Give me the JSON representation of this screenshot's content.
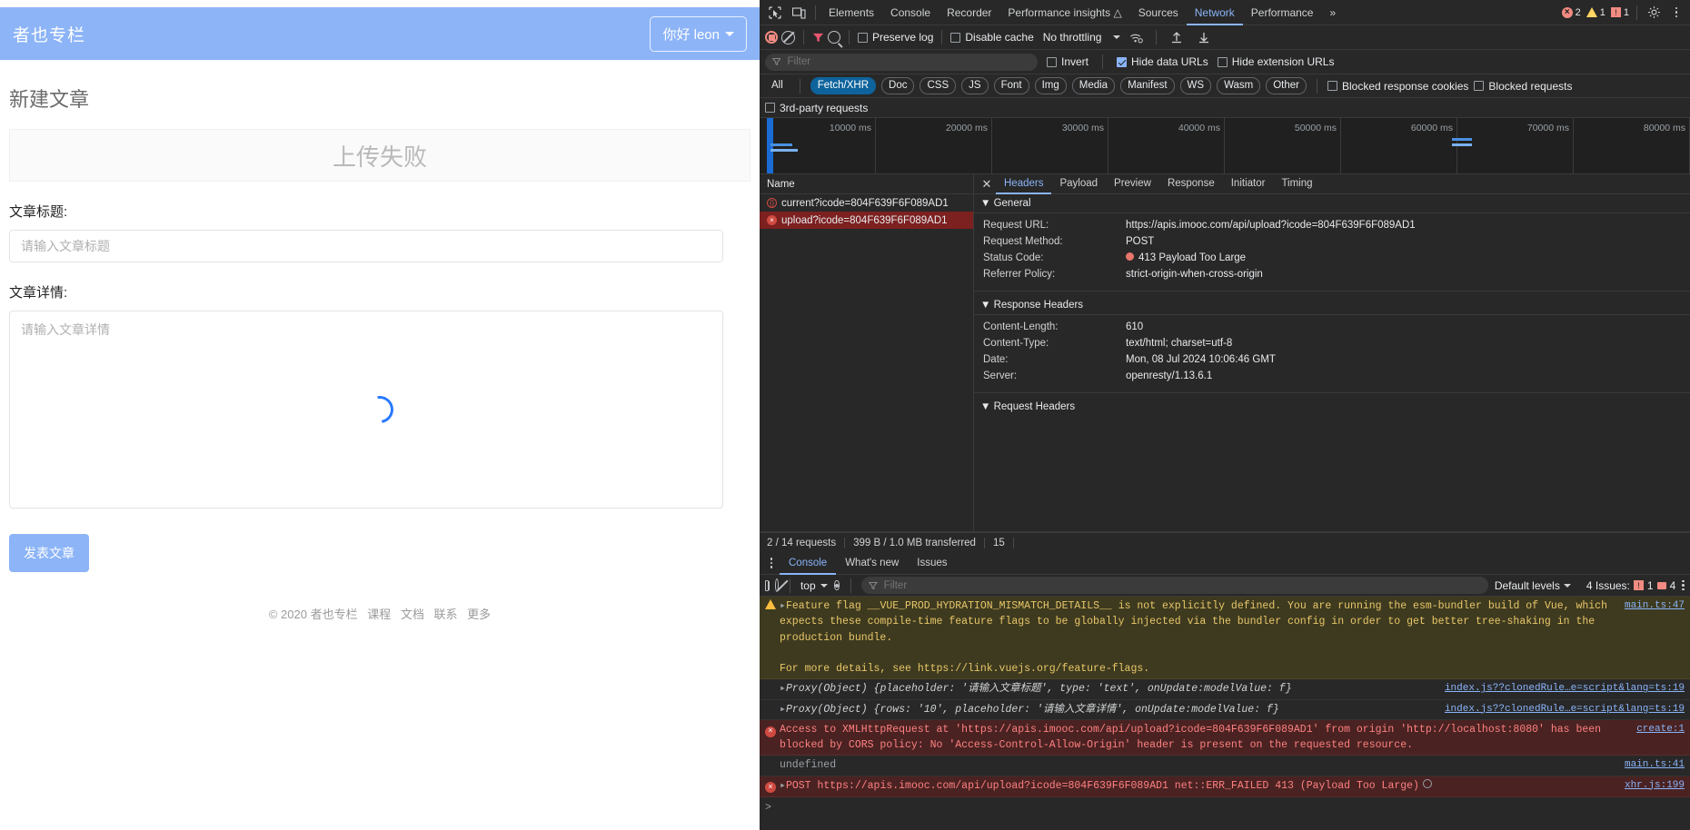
{
  "webpage": {
    "brand": "者也专栏",
    "user_button": "你好 leon",
    "page_title": "新建文章",
    "upload_status": "上传失败",
    "title_label": "文章标题:",
    "title_placeholder": "请输入文章标题",
    "title_value": "",
    "detail_label": "文章详情:",
    "detail_placeholder": "请输入文章详情",
    "detail_value": "",
    "submit_label": "发表文章",
    "footer": {
      "copyright": "© 2020 者也专栏",
      "links": [
        "课程",
        "文档",
        "联系",
        "更多"
      ]
    },
    "accent_color": "#8cb4f7"
  },
  "devtools": {
    "tabs": [
      {
        "label": "Elements",
        "active": false
      },
      {
        "label": "Console",
        "active": false
      },
      {
        "label": "Recorder",
        "active": false
      },
      {
        "label": "Performance insights",
        "active": false
      },
      {
        "label": "Sources",
        "active": false
      },
      {
        "label": "Network",
        "active": true
      },
      {
        "label": "Performance",
        "active": false
      }
    ],
    "overflow_label": "»",
    "counters": {
      "errors": "2",
      "warnings": "1",
      "issues": "1"
    },
    "network_toolbar": {
      "preserve_log": "Preserve log",
      "preserve_log_checked": false,
      "disable_cache": "Disable cache",
      "disable_cache_checked": false,
      "throttling": "No throttling"
    },
    "filter_bar": {
      "placeholder": "Filter",
      "value": "",
      "invert": "Invert",
      "invert_checked": false,
      "hide_data_urls": "Hide data URLs",
      "hide_data_urls_checked": true,
      "hide_extension_urls": "Hide extension URLs",
      "hide_extension_urls_checked": false
    },
    "type_filters": [
      {
        "label": "All",
        "active": false
      },
      {
        "label": "Fetch/XHR",
        "active": true
      },
      {
        "label": "Doc",
        "active": false
      },
      {
        "label": "CSS",
        "active": false
      },
      {
        "label": "JS",
        "active": false
      },
      {
        "label": "Font",
        "active": false
      },
      {
        "label": "Img",
        "active": false
      },
      {
        "label": "Media",
        "active": false
      },
      {
        "label": "Manifest",
        "active": false
      },
      {
        "label": "WS",
        "active": false
      },
      {
        "label": "Wasm",
        "active": false
      },
      {
        "label": "Other",
        "active": false
      }
    ],
    "blocked_response_cookies": "Blocked response cookies",
    "blocked_requests": "Blocked requests",
    "third_party_requests": "3rd-party requests",
    "timeline_ticks": [
      "10000 ms",
      "20000 ms",
      "30000 ms",
      "40000 ms",
      "50000 ms",
      "60000 ms",
      "70000 ms",
      "80000 ms"
    ],
    "request_list": {
      "header": "Name",
      "rows": [
        {
          "name": "current?icode=804F639F6F089AD1",
          "status": "code",
          "selected": false
        },
        {
          "name": "upload?icode=804F639F6F089AD1",
          "status": "error",
          "selected": true
        }
      ]
    },
    "detail_tabs": [
      {
        "label": "Headers",
        "active": true
      },
      {
        "label": "Payload",
        "active": false
      },
      {
        "label": "Preview",
        "active": false
      },
      {
        "label": "Response",
        "active": false
      },
      {
        "label": "Initiator",
        "active": false
      },
      {
        "label": "Timing",
        "active": false
      }
    ],
    "sections": {
      "general_title": "General",
      "general": [
        {
          "key": "Request URL:",
          "value": "https://apis.imooc.com/api/upload?icode=804F639F6F089AD1"
        },
        {
          "key": "Request Method:",
          "value": "POST"
        },
        {
          "key": "Status Code:",
          "value": "413 Payload Too Large",
          "has_dot": true
        },
        {
          "key": "Referrer Policy:",
          "value": "strict-origin-when-cross-origin"
        }
      ],
      "response_title": "Response Headers",
      "response": [
        {
          "key": "Content-Length:",
          "value": "610"
        },
        {
          "key": "Content-Type:",
          "value": "text/html; charset=utf-8"
        },
        {
          "key": "Date:",
          "value": "Mon, 08 Jul 2024 10:06:46 GMT"
        },
        {
          "key": "Server:",
          "value": "openresty/1.13.6.1"
        }
      ],
      "request_title": "Request Headers"
    },
    "status_bar": {
      "requests": "2 / 14 requests",
      "transferred": "399 B / 1.0 MB transferred",
      "resources": "15"
    },
    "console": {
      "tabs": [
        {
          "label": "Console",
          "active": true
        },
        {
          "label": "What's new",
          "active": false
        },
        {
          "label": "Issues",
          "active": false
        }
      ],
      "context": "top",
      "filter_placeholder": "Filter",
      "filter_value": "",
      "levels": "Default levels",
      "issues_label": "4 Issues:",
      "issues_errors": "1",
      "issues_warnings": "4",
      "messages": [
        {
          "type": "warn",
          "text": "Feature flag __VUE_PROD_HYDRATION_MISMATCH_DETAILS__ is not explicitly defined. You are running the esm-bundler build of Vue, which expects these compile-time feature flags to be globally injected via the bundler config in order to get better tree-shaking in the production bundle.\n\nFor more details, see https://link.vuejs.org/feature-flags.",
          "link": "https://link.vuejs.org/feature-flags",
          "source": "main.ts:47"
        },
        {
          "type": "info",
          "text": "Proxy(Object) {placeholder: '请输入文章标题', type: 'text', onUpdate:modelValue: f}",
          "source": "index.js??clonedRule…e=script&lang=ts:19"
        },
        {
          "type": "info",
          "text": "Proxy(Object) {rows: '10', placeholder: '请输入文章详情', onUpdate:modelValue: f}",
          "source": "index.js??clonedRule…e=script&lang=ts:19"
        },
        {
          "type": "err",
          "text": "Access to XMLHttpRequest at 'https://apis.imooc.com/api/upload?icode=804F639F6F089AD1' from origin 'http://localhost:8080' has been blocked by CORS policy: No 'Access-Control-Allow-Origin' header is present on the requested resource.",
          "source": "create:1"
        },
        {
          "type": "plain",
          "text": "undefined",
          "source": "main.ts:41"
        },
        {
          "type": "err",
          "text": "POST https://apis.imooc.com/api/upload?icode=804F639F6F089AD1 net::ERR_FAILED 413 (Payload Too Large)",
          "source": "xhr.js:199"
        }
      ],
      "prompt": ">"
    }
  }
}
